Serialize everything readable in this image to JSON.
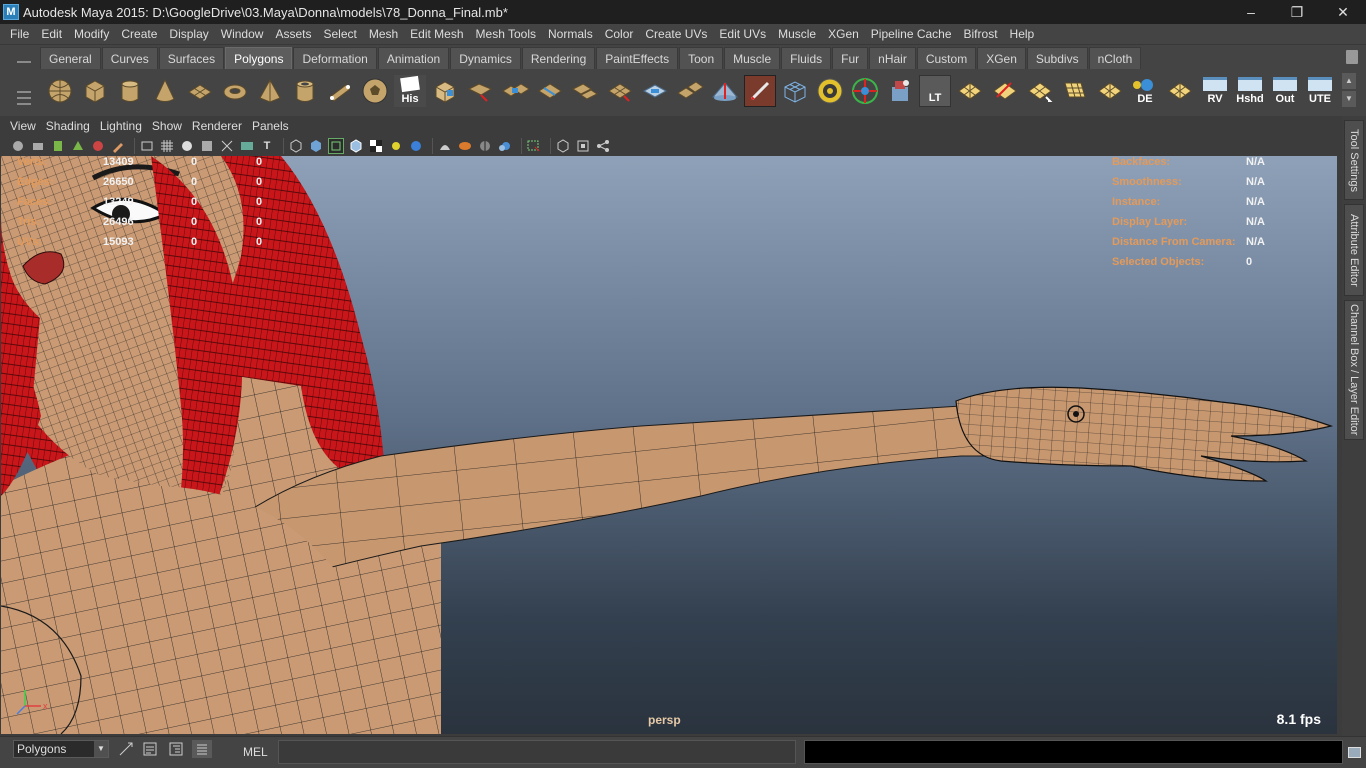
{
  "window": {
    "title": "Autodesk Maya 2015: D:\\GoogleDrive\\03.Maya\\Donna\\models\\78_Donna_Final.mb*",
    "icon_letter": "M",
    "controls": [
      "minimize-icon",
      "restore-icon",
      "close-icon"
    ]
  },
  "menubar": {
    "items": [
      "File",
      "Edit",
      "Modify",
      "Create",
      "Display",
      "Window",
      "Assets",
      "Select",
      "Mesh",
      "Edit Mesh",
      "Mesh Tools",
      "Normals",
      "Color",
      "Create UVs",
      "Edit UVs",
      "Muscle",
      "XGen",
      "Pipeline Cache",
      "Bifrost",
      "Help"
    ]
  },
  "shelf": {
    "tabs": [
      "General",
      "Curves",
      "Surfaces",
      "Polygons",
      "Deformation",
      "Animation",
      "Dynamics",
      "Rendering",
      "PaintEffects",
      "Toon",
      "Muscle",
      "Fluids",
      "Fur",
      "nHair",
      "Custom",
      "XGen",
      "Subdivs",
      "nCloth"
    ],
    "active_tab": "Polygons",
    "icons": [
      "poly-sphere-icon",
      "poly-cube-icon",
      "poly-cylinder-icon",
      "poly-cone-icon",
      "poly-plane-icon",
      "poly-torus-icon",
      "poly-pyramid-icon",
      "poly-pipe-icon",
      "poly-helix-icon",
      "soccer-ball-icon",
      "history-icon",
      "extrude-icon",
      "bridge-icon",
      "append-polygon-icon",
      "insert-edge-loop-icon",
      "split-polygon-icon",
      "merge-icon",
      "combine-icon",
      "separate-icon",
      "bevel-icon",
      "smooth-icon",
      "paint-icon",
      "wireframe-cage-icon",
      "uv-snapshot-icon",
      "uv-editor-icon",
      "transfer-icon",
      "lt-icon",
      "mesh-tool-a-icon",
      "mesh-tool-b-icon",
      "mesh-tool-c-icon",
      "mesh-tool-d-icon",
      "mesh-tool-e-icon",
      "de-icon",
      "mesh-tool-f-icon",
      "rv-icon",
      "hshd-icon",
      "out-icon",
      "ute-icon"
    ],
    "his_label": "His",
    "lt_label": "LT",
    "de_label": "DE",
    "rv_label": "RV",
    "hshd_label": "Hshd",
    "out_label": "Out",
    "ute_label": "UTE"
  },
  "panel": {
    "menus": [
      "View",
      "Shading",
      "Lighting",
      "Show",
      "Renderer",
      "Panels"
    ],
    "camera": "persp",
    "fps": "8.1 fps"
  },
  "hud_left": [
    {
      "label": "Verts:",
      "total": "13409",
      "selected": "0",
      "components": "0"
    },
    {
      "label": "Edges:",
      "total": "26650",
      "selected": "0",
      "components": "0"
    },
    {
      "label": "Faces:",
      "total": "13249",
      "selected": "0",
      "components": "0"
    },
    {
      "label": "Tris:",
      "total": "26496",
      "selected": "0",
      "components": "0"
    },
    {
      "label": "UVs:",
      "total": "15093",
      "selected": "0",
      "components": "0"
    }
  ],
  "hud_right": [
    {
      "label": "Backfaces:",
      "value": "N/A"
    },
    {
      "label": "Smoothness:",
      "value": "N/A"
    },
    {
      "label": "Instance:",
      "value": "N/A"
    },
    {
      "label": "Display Layer:",
      "value": "N/A"
    },
    {
      "label": "Distance From Camera:",
      "value": "N/A"
    },
    {
      "label": "Selected Objects:",
      "value": "0"
    }
  ],
  "side_tabs": [
    "Tool Settings",
    "Attribute Editor",
    "Channel Box / Layer Editor"
  ],
  "cmdline": {
    "menu_set": "Polygons",
    "language": "MEL",
    "input": ""
  },
  "colors": {
    "hud_label": "#e39a5a",
    "hair": "#c8161a",
    "skin": "#c99a74",
    "wire": "#1a1a1a"
  }
}
